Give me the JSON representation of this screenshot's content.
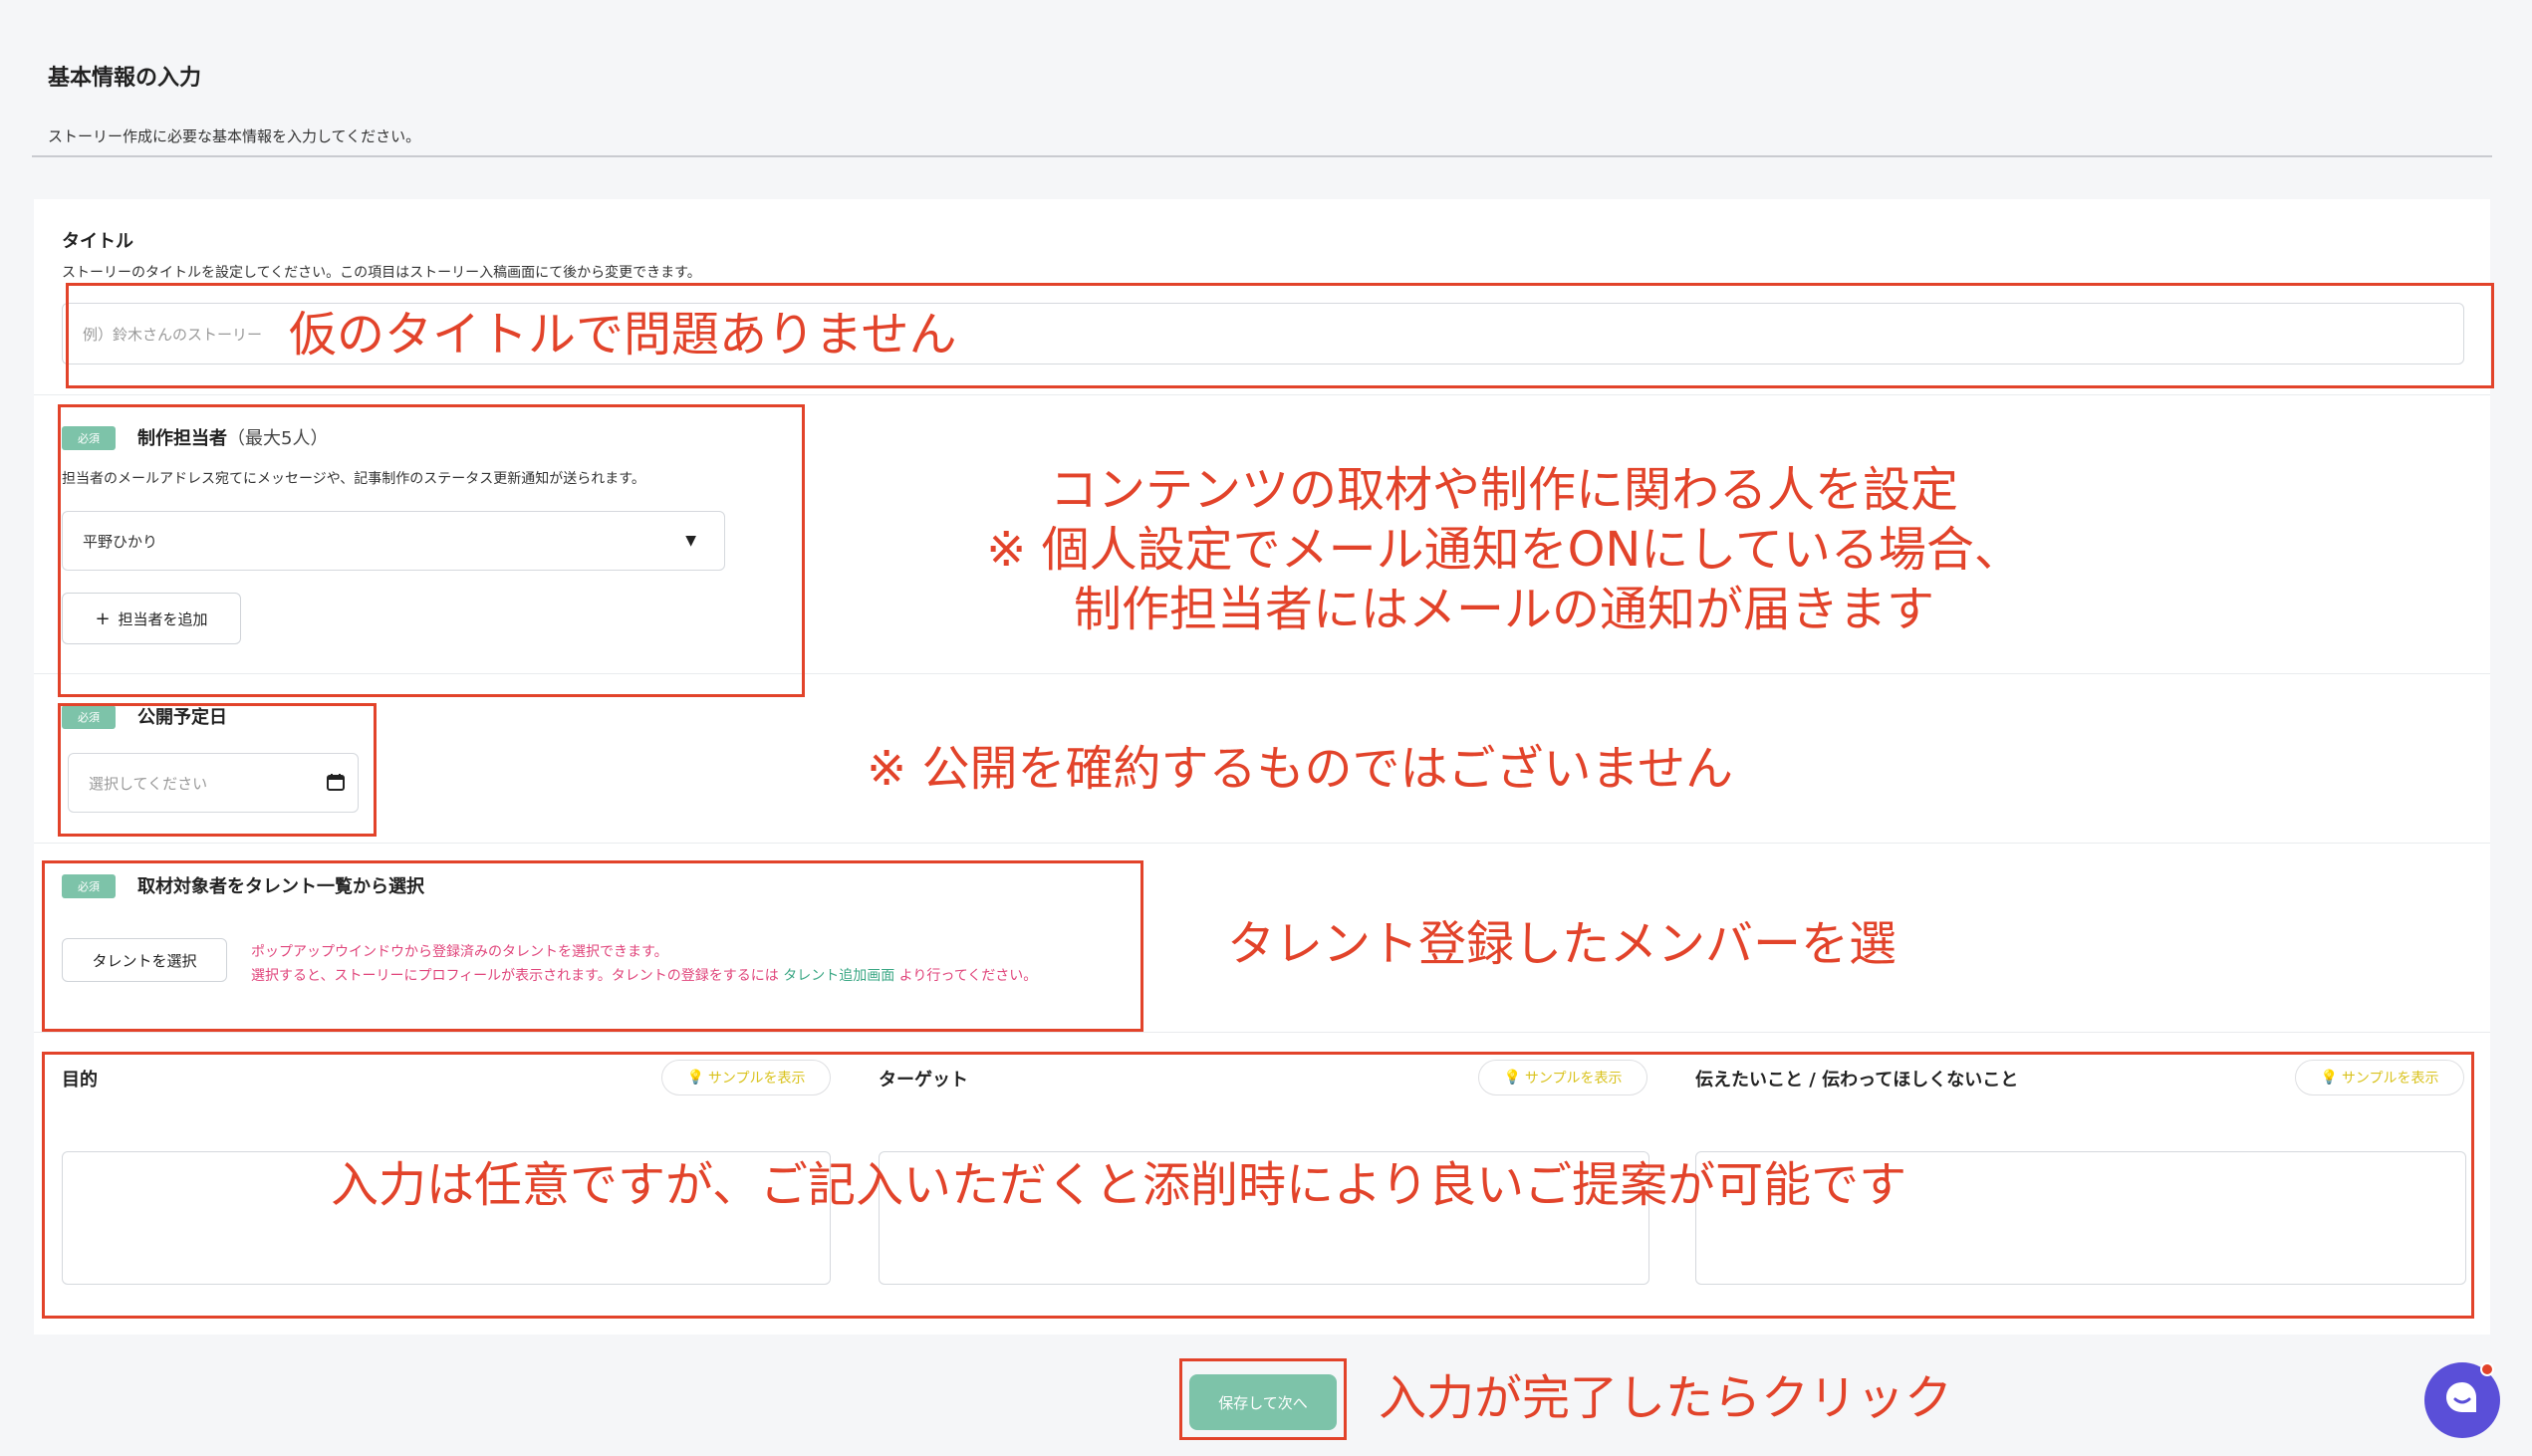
{
  "header": {
    "title": "基本情報の入力",
    "subtitle": "ストーリー作成に必要な基本情報を入力してください。"
  },
  "title_section": {
    "label": "タイトル",
    "description": "ストーリーのタイトルを設定してください。この項目はストーリー入稿画面にて後から変更できます。",
    "placeholder": "例）鈴木さんのストーリー"
  },
  "staff_section": {
    "badge": "必須",
    "label": "制作担当者",
    "label_note": "（最大5人）",
    "description": "担当者のメールアドレス宛てにメッセージや、記事制作のステータス更新通知が送られます。",
    "selected": "平野ひかり",
    "add_button": "担当者を追加"
  },
  "date_section": {
    "badge": "必須",
    "label": "公開予定日",
    "placeholder": "選択してください"
  },
  "talent_section": {
    "badge": "必須",
    "label": "取材対象者をタレント一覧から選択",
    "button": "タレントを選択",
    "note_line1": "ポップアップウインドウから登録済みのタレントを選択できます。",
    "note_line2_pre": "選択すると、ストーリーにプロフィールが表示されます。タレントの登録をするには",
    "note_link": "タレント追加画面",
    "note_line2_post": "より行ってください。"
  },
  "purpose_section": {
    "sample_label": "サンプルを表示",
    "fields": [
      {
        "label": "目的"
      },
      {
        "label": "ターゲット"
      },
      {
        "label": "伝えたいこと / 伝わってほしくないこと"
      }
    ]
  },
  "footer": {
    "save_button": "保存して次へ"
  },
  "annotations": {
    "title_note": "仮のタイトルで問題ありません",
    "staff_note_line1": "コンテンツの取材や制作に関わる人を設定",
    "staff_note_line2": "※ 個人設定でメール通知をONにしている場合、",
    "staff_note_line3": "制作担当者にはメールの通知が届きます",
    "date_note": "※ 公開を確約するものではございません",
    "talent_note": "タレント登録したメンバーを選",
    "purpose_note": "入力は任意ですが、ご記入いただくと添削時により良いご提案が可能です",
    "save_note": "入力が完了したらクリック"
  },
  "colors": {
    "accent_green": "#7dc3a9",
    "annotation_red": "#e2432a",
    "notice_pink": "#e0457b",
    "link_green": "#3aa784",
    "sample_yellow": "#d9c21c",
    "chat_purple": "#5a4fd8"
  }
}
